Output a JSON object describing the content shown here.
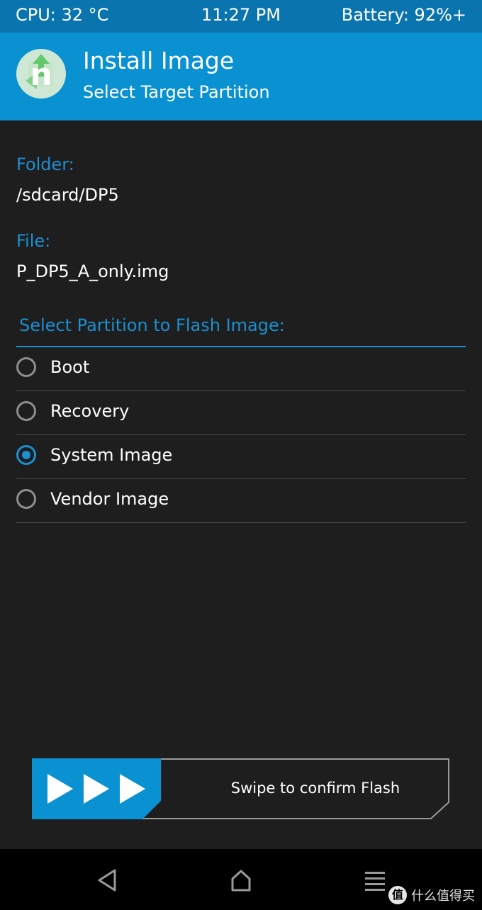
{
  "status_bar": {
    "cpu": "CPU: 32 °C",
    "time": "11:27 PM",
    "battery": "Battery: 92%+"
  },
  "header": {
    "title": "Install Image",
    "subtitle": "Select Target Partition",
    "logo_icon": "twrp-n-logo-icon"
  },
  "folder": {
    "label": "Folder:",
    "value": "/sdcard/DP5"
  },
  "file": {
    "label": "File:",
    "value": "P_DP5_A_only.img"
  },
  "partition_select": {
    "title": "Select Partition to Flash Image:",
    "options": [
      {
        "label": "Boot",
        "selected": false
      },
      {
        "label": "Recovery",
        "selected": false
      },
      {
        "label": "System Image",
        "selected": true
      },
      {
        "label": "Vendor Image",
        "selected": false
      }
    ]
  },
  "swipe": {
    "label": "Swipe to confirm Flash",
    "handle_icon": "triple-arrow-right-icon"
  },
  "nav_bar": {
    "back_icon": "back-triangle-icon",
    "home_icon": "home-icon",
    "menu_icon": "menu-lines-icon"
  },
  "watermark": {
    "badge": "值",
    "text": "什么值得买"
  },
  "colors": {
    "status_bar": "#0a74ae",
    "header": "#0a91d2",
    "accent": "#1b8fd1",
    "background": "#1e1e1e",
    "nav_bar": "#000000"
  }
}
